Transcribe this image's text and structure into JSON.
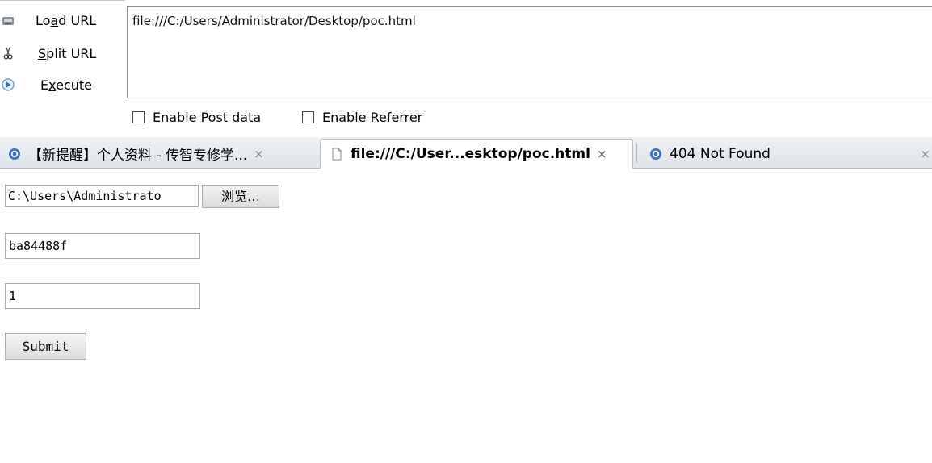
{
  "hackbar": {
    "buttons": [
      {
        "label_pre": "Lo",
        "label_u": "a",
        "label_post": "d URL",
        "icon": "load-url-icon"
      },
      {
        "label_pre": "",
        "label_u": "S",
        "label_post": "plit URL",
        "icon": "scissors-icon"
      },
      {
        "label_pre": "E",
        "label_u": "x",
        "label_post": "ecute",
        "icon": "play-icon"
      }
    ],
    "url_value": "file:///C:/Users/Administrator/Desktop/poc.html",
    "enable_post_label": "Enable Post data",
    "enable_referrer_label": "Enable Referrer"
  },
  "tabs": [
    {
      "title": "【新提醒】个人资料 - 传智专修学...",
      "close": "×",
      "icon": "site-globe-icon"
    },
    {
      "title": "file:///C:/User...esktop/poc.html",
      "close": "×",
      "icon": "page-icon"
    },
    {
      "title": "404 Not Found",
      "close": "×",
      "icon": "site-globe-icon"
    }
  ],
  "form": {
    "file_value": "C:\\Users\\Administrato",
    "browse_label": "浏览…",
    "field1_value": "ba84488f",
    "field2_value": "1",
    "submit_label": "Submit"
  },
  "colors": {
    "tab_background": "#dfe4ea",
    "border": "#a9a9a9"
  }
}
